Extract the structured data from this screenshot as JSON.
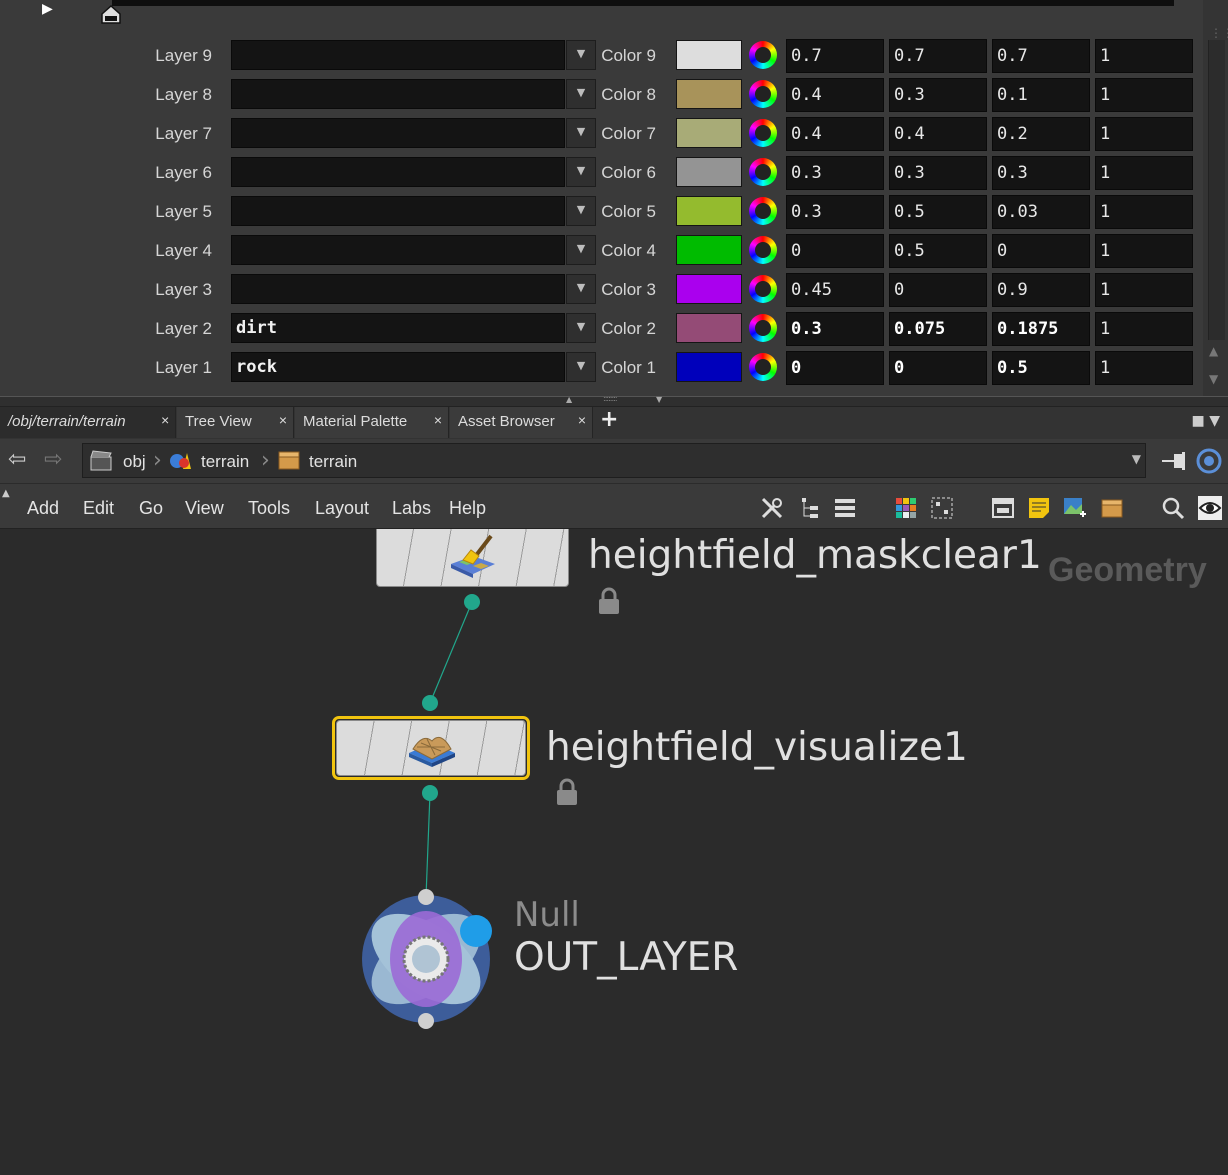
{
  "playbar": {
    "play_icon": "play-icon",
    "home_icon": "home-marker-icon"
  },
  "params": {
    "layers": [
      {
        "label": "Layer 9",
        "name": "",
        "color_label": "Color 9",
        "swatch": "#dddddd",
        "r": "0.7",
        "g": "0.7",
        "b": "0.7",
        "a": "1",
        "bold": false
      },
      {
        "label": "Layer 8",
        "name": "",
        "color_label": "Color 8",
        "swatch": "#a8935a",
        "r": "0.4",
        "g": "0.3",
        "b": "0.1",
        "a": "1",
        "bold": false
      },
      {
        "label": "Layer 7",
        "name": "",
        "color_label": "Color 7",
        "swatch": "#a8ab77",
        "r": "0.4",
        "g": "0.4",
        "b": "0.2",
        "a": "1",
        "bold": false
      },
      {
        "label": "Layer 6",
        "name": "",
        "color_label": "Color 6",
        "swatch": "#949494",
        "r": "0.3",
        "g": "0.3",
        "b": "0.3",
        "a": "1",
        "bold": false
      },
      {
        "label": "Layer 5",
        "name": "",
        "color_label": "Color 5",
        "swatch": "#94bb2e",
        "r": "0.3",
        "g": "0.5",
        "b": "0.03",
        "a": "1",
        "bold": false
      },
      {
        "label": "Layer 4",
        "name": "",
        "color_label": "Color 4",
        "swatch": "#00bb00",
        "r": "0",
        "g": "0.5",
        "b": "0",
        "a": "1",
        "bold": false
      },
      {
        "label": "Layer 3",
        "name": "",
        "color_label": "Color 3",
        "swatch": "#aa00ee",
        "r": "0.45",
        "g": "0",
        "b": "0.9",
        "a": "1",
        "bold": false
      },
      {
        "label": "Layer 2",
        "name": "dirt",
        "color_label": "Color 2",
        "swatch": "#944b76",
        "r": "0.3",
        "g": "0.075",
        "b": "0.1875",
        "a": "1",
        "bold": true
      },
      {
        "label": "Layer 1",
        "name": "rock",
        "color_label": "Color 1",
        "swatch": "#0000bb",
        "r": "0",
        "g": "0",
        "b": "0.5",
        "a": "1",
        "bold": true
      }
    ]
  },
  "tabs": [
    {
      "label": "/obj/terrain/terrain",
      "active": true
    },
    {
      "label": "Tree View",
      "active": false
    },
    {
      "label": "Material Palette",
      "active": false
    },
    {
      "label": "Asset Browser",
      "active": false
    }
  ],
  "add_tab_label": "+",
  "close_glyph": "×",
  "path": {
    "crumbs": [
      "obj",
      "terrain",
      "terrain"
    ]
  },
  "menu": [
    "Add",
    "Edit",
    "Go",
    "View",
    "Tools",
    "Layout",
    "Labs",
    "Help"
  ],
  "network": {
    "context": "Geometry",
    "nodes": {
      "maskclear": {
        "name": "heightfield_maskclear1",
        "icon": "broom-icon"
      },
      "visualize": {
        "name": "heightfield_visualize1",
        "icon": "heightfield-icon",
        "selected": true
      },
      "null": {
        "type": "Null",
        "name": "OUT_LAYER"
      }
    },
    "wire_color": "#21a78c",
    "selected_color": "#f1c40f"
  }
}
